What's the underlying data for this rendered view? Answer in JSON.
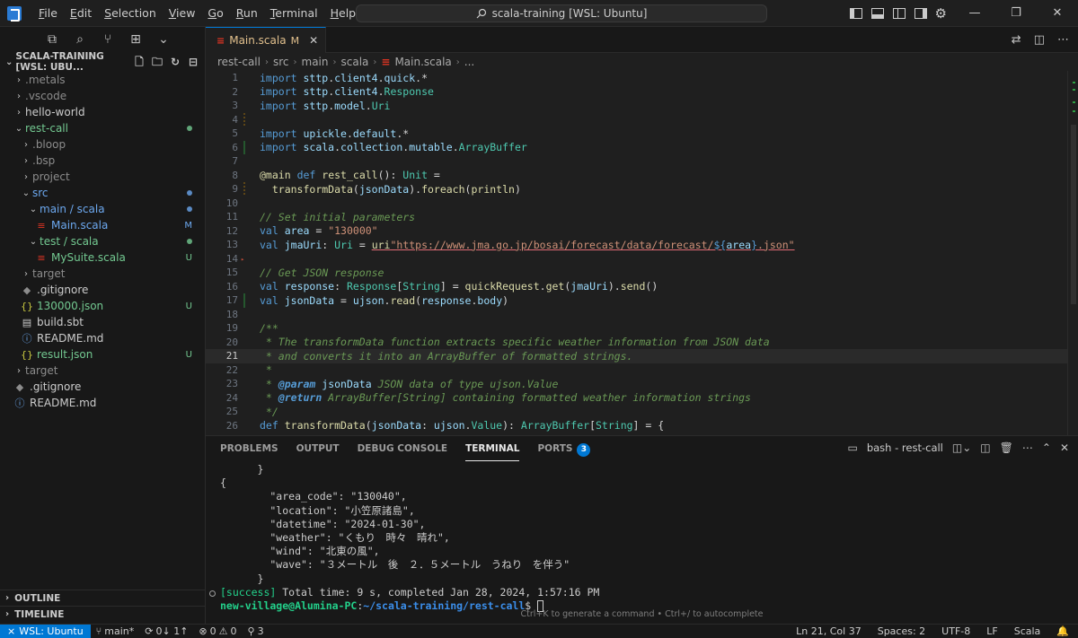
{
  "menu": [
    "File",
    "Edit",
    "Selection",
    "View",
    "Go",
    "Run",
    "Terminal",
    "Help"
  ],
  "command_center": "scala-training [WSL: Ubuntu]",
  "explorer": {
    "title": "SCALA-TRAINING [WSL: UBU...",
    "tree": [
      {
        "label": ".metals",
        "indent": 0,
        "type": "folder",
        "open": false,
        "color": "gray",
        "badge": ""
      },
      {
        "label": ".vscode",
        "indent": 0,
        "type": "folder",
        "open": false,
        "color": "gray",
        "badge": ""
      },
      {
        "label": "hello-world",
        "indent": 0,
        "type": "folder",
        "open": false,
        "color": "normal",
        "badge": ""
      },
      {
        "label": "rest-call",
        "indent": 0,
        "type": "folder",
        "open": true,
        "color": "untracked",
        "badge": "dot-green"
      },
      {
        "label": ".bloop",
        "indent": 1,
        "type": "folder",
        "open": false,
        "color": "gray",
        "badge": ""
      },
      {
        "label": ".bsp",
        "indent": 1,
        "type": "folder",
        "open": false,
        "color": "gray",
        "badge": ""
      },
      {
        "label": "project",
        "indent": 1,
        "type": "folder",
        "open": false,
        "color": "gray",
        "badge": ""
      },
      {
        "label": "src",
        "indent": 1,
        "type": "folder",
        "open": true,
        "color": "blue",
        "badge": "dot-blue"
      },
      {
        "label": "main / scala",
        "indent": 2,
        "type": "folder",
        "open": true,
        "color": "blue",
        "badge": "dot-blue"
      },
      {
        "label": "Main.scala",
        "indent": 3,
        "type": "scala",
        "open": false,
        "color": "blue",
        "badge": "M"
      },
      {
        "label": "test / scala",
        "indent": 2,
        "type": "folder",
        "open": true,
        "color": "untracked",
        "badge": "dot-green"
      },
      {
        "label": "MySuite.scala",
        "indent": 3,
        "type": "scala",
        "open": false,
        "color": "untracked",
        "badge": "U"
      },
      {
        "label": "target",
        "indent": 1,
        "type": "folder",
        "open": false,
        "color": "gray",
        "badge": ""
      },
      {
        "label": ".gitignore",
        "indent": 1,
        "type": "git",
        "open": false,
        "color": "normal",
        "badge": ""
      },
      {
        "label": "130000.json",
        "indent": 1,
        "type": "json",
        "open": false,
        "color": "untracked",
        "badge": "U"
      },
      {
        "label": "build.sbt",
        "indent": 1,
        "type": "sbt",
        "open": false,
        "color": "normal",
        "badge": ""
      },
      {
        "label": "README.md",
        "indent": 1,
        "type": "info",
        "open": false,
        "color": "normal",
        "badge": ""
      },
      {
        "label": "result.json",
        "indent": 1,
        "type": "json",
        "open": false,
        "color": "untracked",
        "badge": "U"
      },
      {
        "label": "target",
        "indent": 0,
        "type": "folder",
        "open": false,
        "color": "gray",
        "badge": ""
      },
      {
        "label": ".gitignore",
        "indent": 0,
        "type": "git",
        "open": false,
        "color": "normal",
        "badge": ""
      },
      {
        "label": "README.md",
        "indent": 0,
        "type": "info",
        "open": false,
        "color": "normal",
        "badge": ""
      }
    ],
    "outline": "OUTLINE",
    "timeline": "TIMELINE"
  },
  "editor": {
    "tab_label": "Main.scala",
    "tab_badge": "M",
    "breadcrumb": [
      "rest-call",
      "src",
      "main",
      "scala",
      "Main.scala",
      "..."
    ],
    "current_line": 21,
    "lines": [
      {
        "n": 1,
        "g": "",
        "tokens": [
          [
            "kw",
            "import"
          ],
          [
            "plain",
            " "
          ],
          [
            "var",
            "sttp"
          ],
          [
            "plain",
            "."
          ],
          [
            "var",
            "client4"
          ],
          [
            "plain",
            "."
          ],
          [
            "var",
            "quick"
          ],
          [
            "plain",
            "."
          ],
          [
            "plain",
            "*"
          ]
        ]
      },
      {
        "n": 2,
        "g": "",
        "tokens": [
          [
            "kw",
            "import"
          ],
          [
            "plain",
            " "
          ],
          [
            "var",
            "sttp"
          ],
          [
            "plain",
            "."
          ],
          [
            "var",
            "client4"
          ],
          [
            "plain",
            "."
          ],
          [
            "ty",
            "Response"
          ]
        ]
      },
      {
        "n": 3,
        "g": "",
        "tokens": [
          [
            "kw",
            "import"
          ],
          [
            "plain",
            " "
          ],
          [
            "var",
            "sttp"
          ],
          [
            "plain",
            "."
          ],
          [
            "var",
            "model"
          ],
          [
            "plain",
            "."
          ],
          [
            "ty",
            "Uri"
          ]
        ]
      },
      {
        "n": 4,
        "g": "mod",
        "tokens": []
      },
      {
        "n": 5,
        "g": "",
        "tokens": [
          [
            "kw",
            "import"
          ],
          [
            "plain",
            " "
          ],
          [
            "var",
            "upickle"
          ],
          [
            "plain",
            "."
          ],
          [
            "var",
            "default"
          ],
          [
            "plain",
            "."
          ],
          [
            "plain",
            "*"
          ]
        ]
      },
      {
        "n": 6,
        "g": "add",
        "tokens": [
          [
            "kw",
            "import"
          ],
          [
            "plain",
            " "
          ],
          [
            "var",
            "scala"
          ],
          [
            "plain",
            "."
          ],
          [
            "var",
            "collection"
          ],
          [
            "plain",
            "."
          ],
          [
            "var",
            "mutable"
          ],
          [
            "plain",
            "."
          ],
          [
            "ty",
            "ArrayBuffer"
          ]
        ]
      },
      {
        "n": 7,
        "g": "",
        "tokens": []
      },
      {
        "n": 8,
        "g": "",
        "tokens": [
          [
            "ann",
            "@main"
          ],
          [
            "plain",
            " "
          ],
          [
            "kw",
            "def"
          ],
          [
            "plain",
            " "
          ],
          [
            "fn",
            "rest_call"
          ],
          [
            "plain",
            "(): "
          ],
          [
            "ty",
            "Unit"
          ],
          [
            "plain",
            " ="
          ]
        ]
      },
      {
        "n": 9,
        "g": "mod",
        "tokens": [
          [
            "plain",
            "  "
          ],
          [
            "fn",
            "transformData"
          ],
          [
            "plain",
            "("
          ],
          [
            "var",
            "jsonData"
          ],
          [
            "plain",
            ")."
          ],
          [
            "fn",
            "foreach"
          ],
          [
            "plain",
            "("
          ],
          [
            "fn",
            "println"
          ],
          [
            "plain",
            ")"
          ]
        ]
      },
      {
        "n": 10,
        "g": "",
        "tokens": []
      },
      {
        "n": 11,
        "g": "",
        "tokens": [
          [
            "cmt",
            "// Set initial parameters"
          ]
        ]
      },
      {
        "n": 12,
        "g": "",
        "tokens": [
          [
            "kw",
            "val"
          ],
          [
            "plain",
            " "
          ],
          [
            "var",
            "area"
          ],
          [
            "plain",
            " = "
          ],
          [
            "str",
            "\"130000\""
          ]
        ]
      },
      {
        "n": 13,
        "g": "",
        "tokens": [
          [
            "kw",
            "val"
          ],
          [
            "plain",
            " "
          ],
          [
            "var",
            "jmaUri"
          ],
          [
            "plain",
            ": "
          ],
          [
            "ty",
            "Uri"
          ],
          [
            "plain",
            " = "
          ],
          [
            "fn",
            "uri"
          ],
          [
            "str",
            "\"https://www.jma.go.jp/bosai/forecast/data/forecast/"
          ],
          [
            "interp",
            "${"
          ],
          [
            "var",
            "area"
          ],
          [
            "interp",
            "}"
          ],
          [
            "str",
            ".json\""
          ]
        ]
      },
      {
        "n": 14,
        "g": "del",
        "tokens": []
      },
      {
        "n": 15,
        "g": "",
        "tokens": [
          [
            "cmt",
            "// Get JSON response"
          ]
        ]
      },
      {
        "n": 16,
        "g": "",
        "tokens": [
          [
            "kw",
            "val"
          ],
          [
            "plain",
            " "
          ],
          [
            "var",
            "response"
          ],
          [
            "plain",
            ": "
          ],
          [
            "ty",
            "Response"
          ],
          [
            "plain",
            "["
          ],
          [
            "ty",
            "String"
          ],
          [
            "plain",
            "] = "
          ],
          [
            "fn",
            "quickRequest"
          ],
          [
            "plain",
            "."
          ],
          [
            "fn",
            "get"
          ],
          [
            "plain",
            "("
          ],
          [
            "var",
            "jmaUri"
          ],
          [
            "plain",
            ")."
          ],
          [
            "fn",
            "send"
          ],
          [
            "plain",
            "()"
          ]
        ]
      },
      {
        "n": 17,
        "g": "add",
        "tokens": [
          [
            "kw",
            "val"
          ],
          [
            "plain",
            " "
          ],
          [
            "var",
            "jsonData"
          ],
          [
            "plain",
            " = "
          ],
          [
            "var",
            "ujson"
          ],
          [
            "plain",
            "."
          ],
          [
            "fn",
            "read"
          ],
          [
            "plain",
            "("
          ],
          [
            "var",
            "response"
          ],
          [
            "plain",
            "."
          ],
          [
            "var",
            "body"
          ],
          [
            "plain",
            ")"
          ]
        ]
      },
      {
        "n": 18,
        "g": "",
        "tokens": []
      },
      {
        "n": 19,
        "g": "",
        "tokens": [
          [
            "cmt",
            "/**"
          ]
        ]
      },
      {
        "n": 20,
        "g": "",
        "tokens": [
          [
            "cmt",
            " * The transformData function extracts specific weather information from JSON data"
          ]
        ]
      },
      {
        "n": 21,
        "g": "",
        "tokens": [
          [
            "cmt",
            " * and converts it into an ArrayBuffer of formatted strings."
          ]
        ]
      },
      {
        "n": 22,
        "g": "",
        "tokens": [
          [
            "cmt",
            " *"
          ]
        ]
      },
      {
        "n": 23,
        "g": "",
        "tokens": [
          [
            "cmt",
            " * "
          ],
          [
            "doc",
            "@param"
          ],
          [
            "cmt",
            " "
          ],
          [
            "var",
            "jsonData"
          ],
          [
            "cmt",
            " JSON data of type ujson.Value"
          ]
        ]
      },
      {
        "n": 24,
        "g": "",
        "tokens": [
          [
            "cmt",
            " * "
          ],
          [
            "doc",
            "@return"
          ],
          [
            "cmt",
            " ArrayBuffer[String] containing formatted weather information strings"
          ]
        ]
      },
      {
        "n": 25,
        "g": "",
        "tokens": [
          [
            "cmt",
            " */"
          ]
        ]
      },
      {
        "n": 26,
        "g": "",
        "tokens": [
          [
            "kw",
            "def"
          ],
          [
            "plain",
            " "
          ],
          [
            "fn",
            "transformData"
          ],
          [
            "plain",
            "("
          ],
          [
            "var",
            "jsonData"
          ],
          [
            "plain",
            ": "
          ],
          [
            "var",
            "ujson"
          ],
          [
            "plain",
            "."
          ],
          [
            "ty",
            "Value"
          ],
          [
            "plain",
            "): "
          ],
          [
            "ty",
            "ArrayBuffer"
          ],
          [
            "plain",
            "["
          ],
          [
            "ty",
            "String"
          ],
          [
            "plain",
            "] = {"
          ]
        ]
      }
    ]
  },
  "panel": {
    "tabs": [
      "PROBLEMS",
      "OUTPUT",
      "DEBUG CONSOLE",
      "TERMINAL",
      "PORTS"
    ],
    "active_tab": "TERMINAL",
    "ports_count": "3",
    "terminal_name": "bash - rest-call",
    "terminal_lines": [
      "      }",
      "{",
      "        \"area_code\": \"130040\",",
      "        \"location\": \"小笠原諸島\",",
      "        \"datetime\": \"2024-01-30\",",
      "        \"weather\": \"くもり　時々　晴れ\",",
      "        \"wind\": \"北東の風\",",
      "        \"wave\": \"３メートル　後　２．５メートル　うねり　を伴う\"",
      "      }"
    ],
    "success_tag": "[success]",
    "success_msg": " Total time: 9 s, completed Jan 28, 2024, 1:57:16 PM",
    "prompt_user": "new-village@Alumina-PC",
    "prompt_sep": ":",
    "prompt_path": "~/scala-training/rest-call",
    "prompt_end": "$ ",
    "hint": "Ctrl+K to generate a command • Ctrl+/ to autocomplete"
  },
  "status": {
    "remote": "WSL: Ubuntu",
    "branch": "main*",
    "sync": "0↓ 1↑",
    "errors": "0",
    "warnings": "0",
    "ports": "3",
    "position": "Ln 21, Col 37",
    "spaces": "Spaces: 2",
    "encoding": "UTF-8",
    "eol": "LF",
    "language": "Scala"
  }
}
